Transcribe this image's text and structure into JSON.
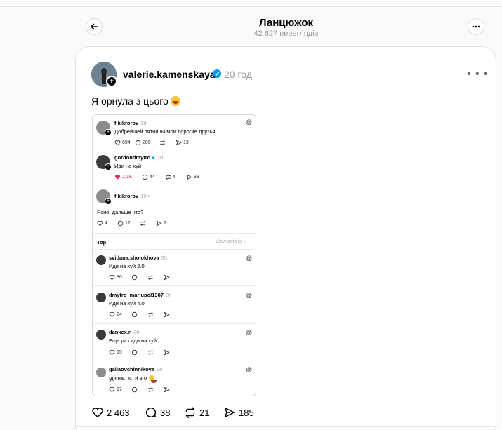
{
  "header": {
    "title": "Ланцюжок",
    "views": "42 627 переглядів"
  },
  "post": {
    "username": "valerie.kamenskaya",
    "time": "20 год",
    "text": "Я орнула з цього",
    "actions": {
      "likes": "2 463",
      "comments": "38",
      "reposts": "21",
      "shares": "185"
    }
  },
  "embedded": {
    "thread": [
      {
        "user": "f.kikrorov",
        "time": "1d",
        "text": "Добрейшей пятницы мои дорогие друзья",
        "likes": "694",
        "comments": "285",
        "reposts": "",
        "shares": "13"
      },
      {
        "user": "gordondmytro",
        "time": "1d",
        "text": "Иди на хуй",
        "likes": "2,1K",
        "comments": "44",
        "reposts": "4",
        "shares": "33"
      },
      {
        "user": "f.kikrorov",
        "time": "10h",
        "text": "Ясно, дальше что?",
        "likes": "4",
        "comments": "12",
        "reposts": "",
        "shares": "2"
      }
    ],
    "top_label": "Top",
    "view_activity": "View activity",
    "replies": [
      {
        "user": "svitlana.sholokhova",
        "time": "9h",
        "text": "Иди на хуй 2.0",
        "likes": "86"
      },
      {
        "user": "dmytro_mariupol1307",
        "time": "8h",
        "text": "Иди на хуй 4.0",
        "likes": "24"
      },
      {
        "user": "dankex.n",
        "time": "8h",
        "text": "Еще раз иди на хуй",
        "likes": "15"
      },
      {
        "user": "galiaovchinnikova",
        "time": "9h",
        "text": "Іди на.. х.. й 3.0",
        "likes": "17"
      }
    ]
  },
  "colors": {
    "verified": "#0095f6",
    "liked": "#e0245e",
    "muted": "#999999"
  },
  "icons": [
    "back-arrow-icon",
    "more-icon",
    "verified-icon",
    "heart-icon",
    "comment-icon",
    "repost-icon",
    "share-icon",
    "threads-icon"
  ]
}
